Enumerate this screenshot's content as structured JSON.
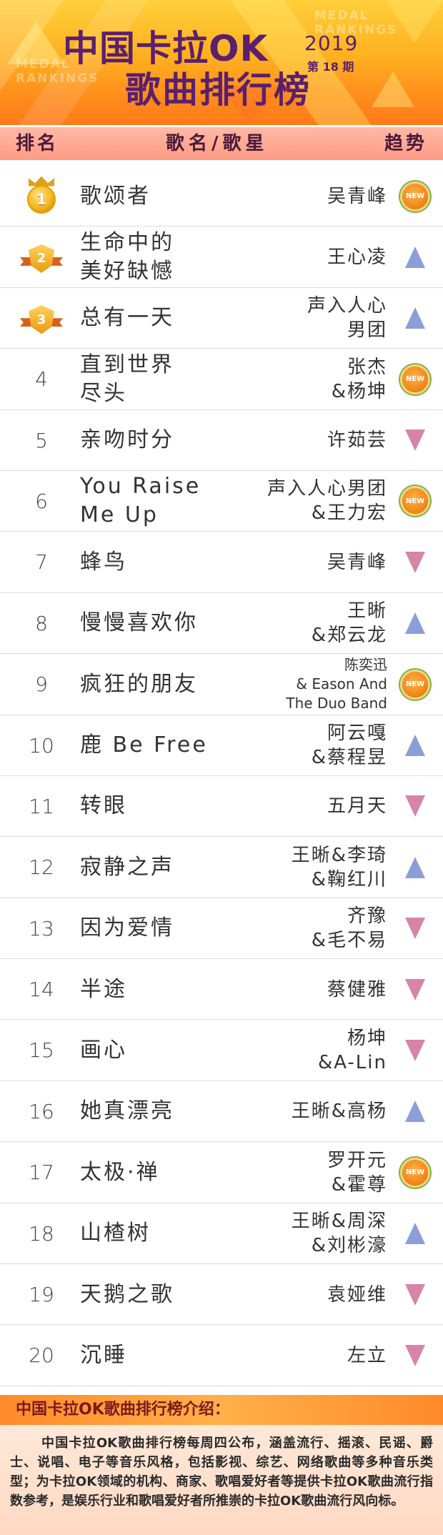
{
  "header": {
    "title_line1": "中国卡拉OK",
    "title_line2": "歌曲排行榜",
    "year": "2019",
    "issue": "第 18 期",
    "watermark": "MEDAL\nRANKINGS"
  },
  "columns": {
    "rank": "排名",
    "song_singer": "歌名/歌星",
    "trend": "趋势"
  },
  "colors": {
    "up": "#8a9fd8",
    "down": "#d883a8",
    "new": "#f18a1a",
    "title": "#5b1f6e"
  },
  "rows": [
    {
      "rank": "1",
      "song": "歌颂者",
      "singer": "吴青峰",
      "trend": "new",
      "medal": "gold-crown"
    },
    {
      "rank": "2",
      "song": "生命中的\n美好缺憾",
      "singer": "王心凌",
      "trend": "up",
      "medal": "silver-ribbon"
    },
    {
      "rank": "3",
      "song": "总有一天",
      "singer": "声入人心\n男团",
      "trend": "up",
      "medal": "bronze-ribbon"
    },
    {
      "rank": "4",
      "song": "直到世界\n尽头",
      "singer": "张杰\n&杨坤",
      "trend": "new"
    },
    {
      "rank": "5",
      "song": "亲吻时分",
      "singer": "许茹芸",
      "trend": "down"
    },
    {
      "rank": "6",
      "song": "You Raise\nMe Up",
      "singer": "声入人心男团\n&王力宏",
      "trend": "new"
    },
    {
      "rank": "7",
      "song": "蜂鸟",
      "singer": "吴青峰",
      "trend": "down"
    },
    {
      "rank": "8",
      "song": "慢慢喜欢你",
      "singer": "王晰\n&郑云龙",
      "trend": "up"
    },
    {
      "rank": "9",
      "song": "疯狂的朋友",
      "singer": "陈奕迅\n& Eason And\nThe Duo Band",
      "trend": "new"
    },
    {
      "rank": "10",
      "song": "鹿 Be Free",
      "singer": "阿云嘎\n&蔡程昱",
      "trend": "up"
    },
    {
      "rank": "11",
      "song": "转眼",
      "singer": "五月天",
      "trend": "down"
    },
    {
      "rank": "12",
      "song": "寂静之声",
      "singer": "王晰&李琦\n&鞠红川",
      "trend": "up"
    },
    {
      "rank": "13",
      "song": "因为爱情",
      "singer": "齐豫\n&毛不易",
      "trend": "down"
    },
    {
      "rank": "14",
      "song": "半途",
      "singer": "蔡健雅",
      "trend": "down"
    },
    {
      "rank": "15",
      "song": "画心",
      "singer": "杨坤\n&A-Lin",
      "trend": "down"
    },
    {
      "rank": "16",
      "song": "她真漂亮",
      "singer": "王晰&高杨",
      "trend": "up"
    },
    {
      "rank": "17",
      "song": "太极·禅",
      "singer": "罗开元\n&霍尊",
      "trend": "new"
    },
    {
      "rank": "18",
      "song": "山楂树",
      "singer": "王晰&周深\n&刘彬濠",
      "trend": "up"
    },
    {
      "rank": "19",
      "song": "天鹅之歌",
      "singer": "袁娅维",
      "trend": "down"
    },
    {
      "rank": "20",
      "song": "沉睡",
      "singer": "左立",
      "trend": "down"
    }
  ],
  "badge_new_label": "NEW",
  "intro": {
    "title": "中国卡拉OK歌曲排行榜介绍：",
    "body": "中国卡拉OK歌曲排行榜每周四公布，涵盖流行、摇滚、民谣、爵士、说唱、电子等音乐风格，包括影视、综艺、网络歌曲等多种音乐类型；为卡拉OK领域的机构、商家、歌唱爱好者等提供卡拉OK歌曲流行指数参考，是娱乐行业和歌唱爱好者所推崇的卡拉OK歌曲流行风向标。"
  }
}
